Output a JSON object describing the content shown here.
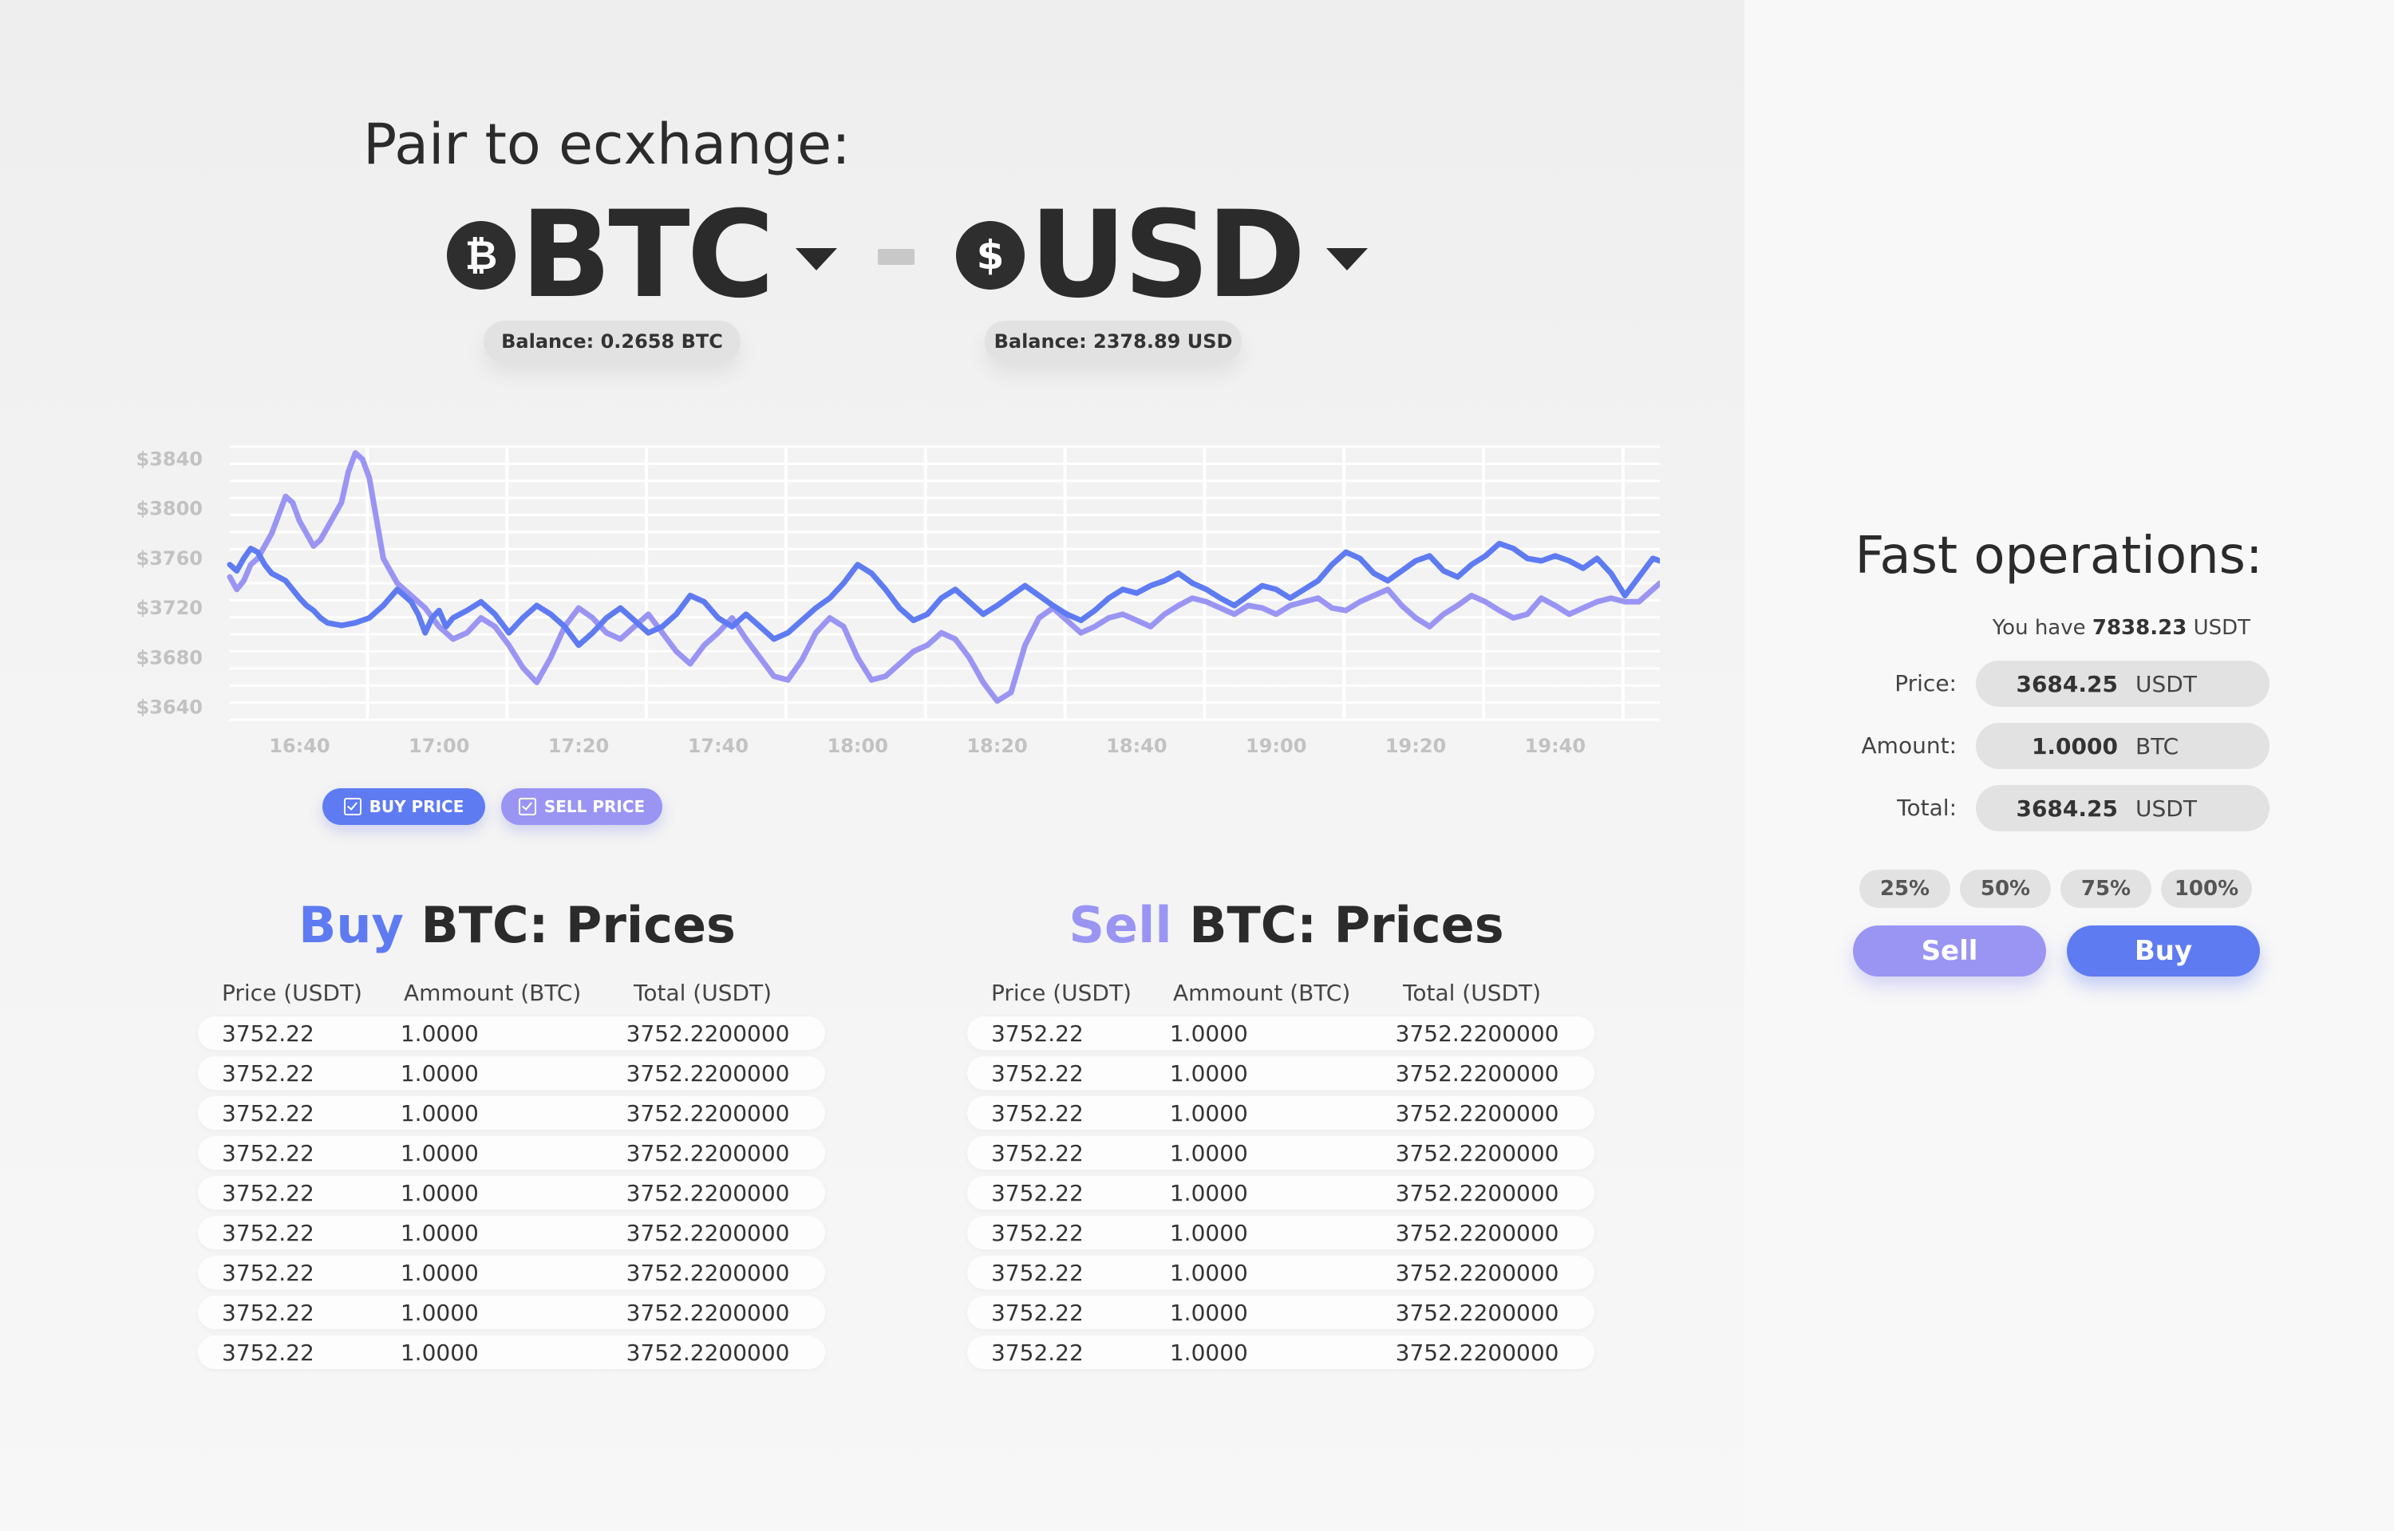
{
  "header": {
    "title": "Pair to ecxhange:",
    "base": {
      "symbol": "₿",
      "code": "BTC",
      "balance": "Balance: 0.2658 BTC"
    },
    "quote": {
      "symbol": "$",
      "code": "USD",
      "balance": "Balance: 2378.89 USD"
    },
    "icons": {
      "base": "bitcoin-icon",
      "quote": "dollar-icon",
      "dropdown": "caret-down-icon"
    }
  },
  "colors": {
    "buy": "#5e7bf2",
    "sell": "#9a95f3",
    "dark": "#2b2b2b",
    "pill": "#e2e2e2"
  },
  "chart_data": {
    "type": "line",
    "title": "",
    "xlabel": "",
    "ylabel": "",
    "x_tick_labels": [
      "16:40",
      "17:00",
      "17:20",
      "17:40",
      "18:00",
      "18:20",
      "18:40",
      "19:00",
      "19:20",
      "19:40"
    ],
    "y_tick_labels": [
      "$3840",
      "$3800",
      "$3760",
      "$3720",
      "$3680",
      "$3640"
    ],
    "y_ticks": [
      3840,
      3800,
      3760,
      3720,
      3680,
      3640
    ],
    "ylim": [
      3630,
      3850
    ],
    "xlim_minutes_from_1630": [
      0,
      205
    ],
    "grid": true,
    "series": [
      {
        "name": "BUY PRICE",
        "color": "#5e7bf2",
        "x": [
          0,
          1,
          2,
          3,
          4,
          5,
          6,
          7,
          8,
          9,
          10,
          11,
          12,
          13,
          14,
          16,
          18,
          20,
          22,
          24,
          26,
          27,
          28,
          29,
          30,
          31,
          32,
          34,
          36,
          38,
          40,
          42,
          44,
          46,
          48,
          50,
          52,
          54,
          56,
          58,
          60,
          62,
          64,
          66,
          68,
          70,
          72,
          74,
          76,
          78,
          80,
          82,
          84,
          86,
          88,
          90,
          92,
          94,
          96,
          98,
          100,
          102,
          104,
          106,
          108,
          110,
          112,
          114,
          116,
          118,
          120,
          122,
          124,
          126,
          128,
          130,
          132,
          134,
          136,
          138,
          140,
          142,
          144,
          146,
          148,
          150,
          152,
          154,
          156,
          158,
          160,
          162,
          164,
          166,
          168,
          170,
          172,
          174,
          176,
          178,
          180,
          182,
          184,
          186,
          188,
          190,
          192,
          194,
          196,
          198,
          200,
          202,
          204,
          205
        ],
        "y": [
          3755,
          3750,
          3760,
          3768,
          3765,
          3755,
          3748,
          3745,
          3742,
          3735,
          3728,
          3722,
          3718,
          3712,
          3708,
          3706,
          3708,
          3712,
          3722,
          3735,
          3725,
          3715,
          3700,
          3712,
          3718,
          3705,
          3712,
          3718,
          3725,
          3715,
          3700,
          3712,
          3722,
          3715,
          3705,
          3690,
          3700,
          3712,
          3720,
          3710,
          3700,
          3705,
          3715,
          3730,
          3725,
          3712,
          3705,
          3715,
          3705,
          3695,
          3700,
          3710,
          3720,
          3728,
          3740,
          3755,
          3748,
          3735,
          3720,
          3710,
          3715,
          3728,
          3735,
          3725,
          3715,
          3722,
          3730,
          3738,
          3730,
          3722,
          3715,
          3710,
          3718,
          3728,
          3735,
          3732,
          3738,
          3742,
          3748,
          3740,
          3735,
          3728,
          3722,
          3730,
          3738,
          3735,
          3728,
          3735,
          3742,
          3755,
          3765,
          3760,
          3748,
          3742,
          3750,
          3758,
          3762,
          3750,
          3745,
          3755,
          3762,
          3772,
          3768,
          3760,
          3758,
          3762,
          3758,
          3752,
          3760,
          3748,
          3730,
          3745,
          3760,
          3758
        ]
      },
      {
        "name": "SELL PRICE",
        "color": "#9a95f3",
        "x": [
          0,
          1,
          2,
          3,
          4,
          5,
          6,
          7,
          8,
          9,
          10,
          11,
          12,
          13,
          14,
          15,
          16,
          17,
          18,
          19,
          20,
          22,
          24,
          26,
          28,
          30,
          32,
          34,
          36,
          38,
          40,
          42,
          44,
          46,
          48,
          50,
          52,
          54,
          56,
          58,
          60,
          62,
          64,
          66,
          68,
          70,
          72,
          74,
          76,
          78,
          80,
          82,
          84,
          86,
          88,
          90,
          92,
          94,
          96,
          98,
          100,
          102,
          104,
          106,
          108,
          110,
          112,
          114,
          116,
          118,
          120,
          122,
          124,
          126,
          128,
          130,
          132,
          134,
          136,
          138,
          140,
          142,
          144,
          146,
          148,
          150,
          152,
          154,
          156,
          158,
          160,
          162,
          164,
          166,
          168,
          170,
          172,
          174,
          176,
          178,
          180,
          182,
          184,
          186,
          188,
          190,
          192,
          194,
          196,
          198,
          200,
          202,
          204,
          205
        ],
        "y": [
          3745,
          3735,
          3742,
          3755,
          3760,
          3770,
          3780,
          3795,
          3810,
          3805,
          3790,
          3780,
          3770,
          3775,
          3785,
          3795,
          3805,
          3830,
          3845,
          3840,
          3825,
          3760,
          3740,
          3730,
          3720,
          3705,
          3695,
          3700,
          3712,
          3705,
          3690,
          3672,
          3660,
          3680,
          3705,
          3720,
          3712,
          3700,
          3695,
          3705,
          3715,
          3700,
          3685,
          3675,
          3690,
          3700,
          3712,
          3695,
          3680,
          3665,
          3662,
          3678,
          3700,
          3712,
          3705,
          3680,
          3662,
          3665,
          3675,
          3685,
          3690,
          3700,
          3695,
          3680,
          3660,
          3645,
          3652,
          3690,
          3712,
          3720,
          3710,
          3700,
          3705,
          3712,
          3715,
          3710,
          3705,
          3715,
          3722,
          3728,
          3725,
          3720,
          3715,
          3722,
          3720,
          3715,
          3722,
          3725,
          3728,
          3720,
          3718,
          3725,
          3730,
          3735,
          3722,
          3712,
          3705,
          3715,
          3722,
          3730,
          3725,
          3718,
          3712,
          3715,
          3728,
          3722,
          3715,
          3720,
          3725,
          3728,
          3725,
          3725,
          3735,
          3740
        ]
      }
    ]
  },
  "toggles": {
    "buy": "BUY PRICE",
    "sell": "SELL PRICE"
  },
  "buy_prices": {
    "highlight": "Buy",
    "title_rest": " BTC: Prices",
    "headers": [
      "Price (USDT)",
      "Ammount (BTC)",
      "Total (USDT)"
    ],
    "rows": [
      [
        "3752.22",
        "1.0000",
        "3752.2200000"
      ],
      [
        "3752.22",
        "1.0000",
        "3752.2200000"
      ],
      [
        "3752.22",
        "1.0000",
        "3752.2200000"
      ],
      [
        "3752.22",
        "1.0000",
        "3752.2200000"
      ],
      [
        "3752.22",
        "1.0000",
        "3752.2200000"
      ],
      [
        "3752.22",
        "1.0000",
        "3752.2200000"
      ],
      [
        "3752.22",
        "1.0000",
        "3752.2200000"
      ],
      [
        "3752.22",
        "1.0000",
        "3752.2200000"
      ],
      [
        "3752.22",
        "1.0000",
        "3752.2200000"
      ]
    ]
  },
  "sell_prices": {
    "highlight": "Sell",
    "title_rest": " BTC: Prices",
    "headers": [
      "Price (USDT)",
      "Ammount (BTC)",
      "Total (USDT)"
    ],
    "rows": [
      [
        "3752.22",
        "1.0000",
        "3752.2200000"
      ],
      [
        "3752.22",
        "1.0000",
        "3752.2200000"
      ],
      [
        "3752.22",
        "1.0000",
        "3752.2200000"
      ],
      [
        "3752.22",
        "1.0000",
        "3752.2200000"
      ],
      [
        "3752.22",
        "1.0000",
        "3752.2200000"
      ],
      [
        "3752.22",
        "1.0000",
        "3752.2200000"
      ],
      [
        "3752.22",
        "1.0000",
        "3752.2200000"
      ],
      [
        "3752.22",
        "1.0000",
        "3752.2200000"
      ],
      [
        "3752.22",
        "1.0000",
        "3752.2200000"
      ]
    ]
  },
  "fast_ops": {
    "title": "Fast operations:",
    "you_have_prefix": "You have",
    "you_have_amount": "7838.23",
    "you_have_unit": "USDT",
    "price": {
      "label": "Price:",
      "value": "3684.25",
      "unit": "USDT"
    },
    "amount": {
      "label": "Amount:",
      "value": "1.0000",
      "unit": "BTC"
    },
    "total": {
      "label": "Total:",
      "value": "3684.25",
      "unit": "USDT"
    },
    "percents": [
      "25%",
      "50%",
      "75%",
      "100%"
    ],
    "sell_label": "Sell",
    "buy_label": "Buy"
  }
}
